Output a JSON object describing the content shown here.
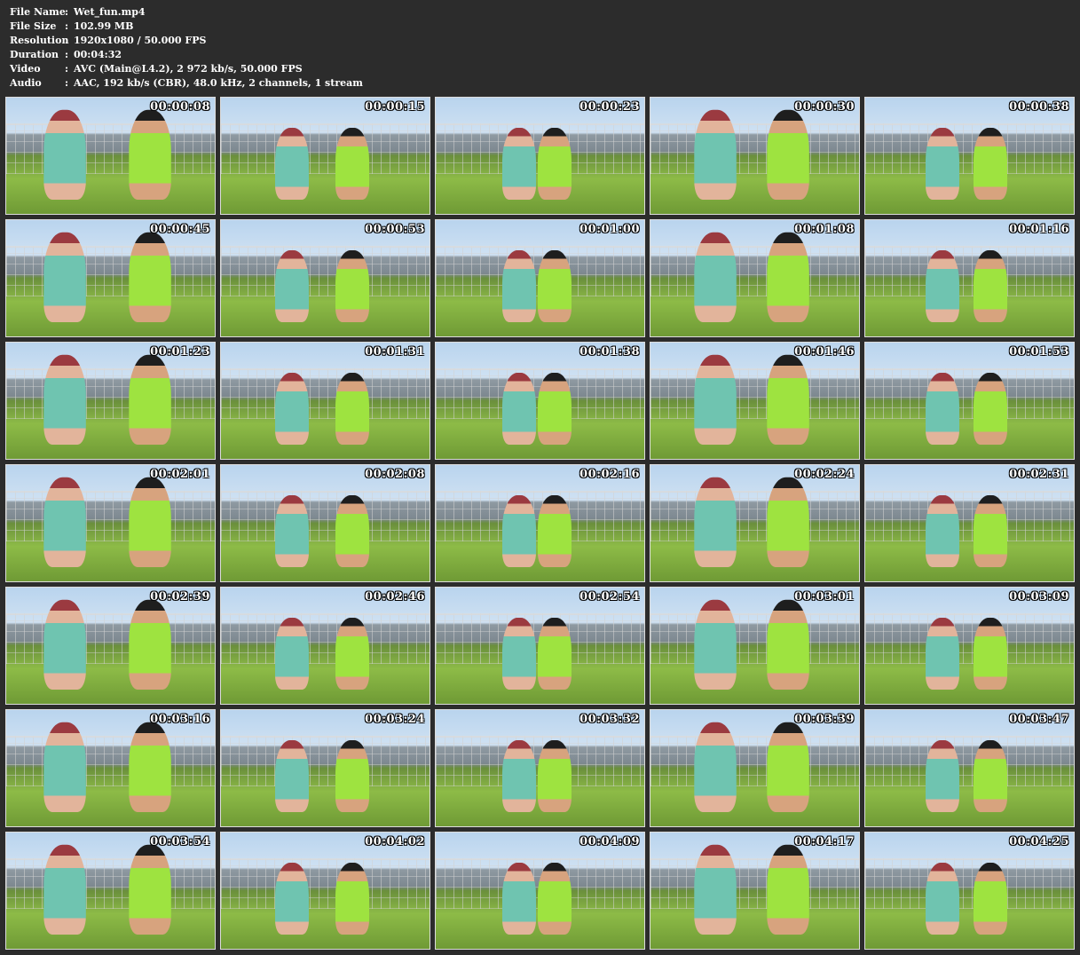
{
  "info": [
    {
      "key": "File Name",
      "value": "Wet_fun.mp4"
    },
    {
      "key": "File Size",
      "value": "102.99 MB"
    },
    {
      "key": "Resolution",
      "value": "1920x1080 / 50.000 FPS"
    },
    {
      "key": "Duration",
      "value": "00:04:32"
    },
    {
      "key": "Video",
      "value": "AVC (Main@L4.2), 2 972 kb/s, 50.000 FPS"
    },
    {
      "key": "Audio",
      "value": "AAC, 192 kb/s (CBR), 48.0 kHz, 2 channels, 1 stream"
    }
  ],
  "separator": ":",
  "thumbnails": [
    "00:00:08",
    "00:00:15",
    "00:00:23",
    "00:00:30",
    "00:00:38",
    "00:00:45",
    "00:00:53",
    "00:01:00",
    "00:01:08",
    "00:01:16",
    "00:01:23",
    "00:01:31",
    "00:01:38",
    "00:01:46",
    "00:01:53",
    "00:02:01",
    "00:02:08",
    "00:02:16",
    "00:02:24",
    "00:02:31",
    "00:02:39",
    "00:02:46",
    "00:02:54",
    "00:03:01",
    "00:03:09",
    "00:03:16",
    "00:03:24",
    "00:03:32",
    "00:03:39",
    "00:03:47",
    "00:03:54",
    "00:04:02",
    "00:04:09",
    "00:04:17",
    "00:04:25"
  ]
}
